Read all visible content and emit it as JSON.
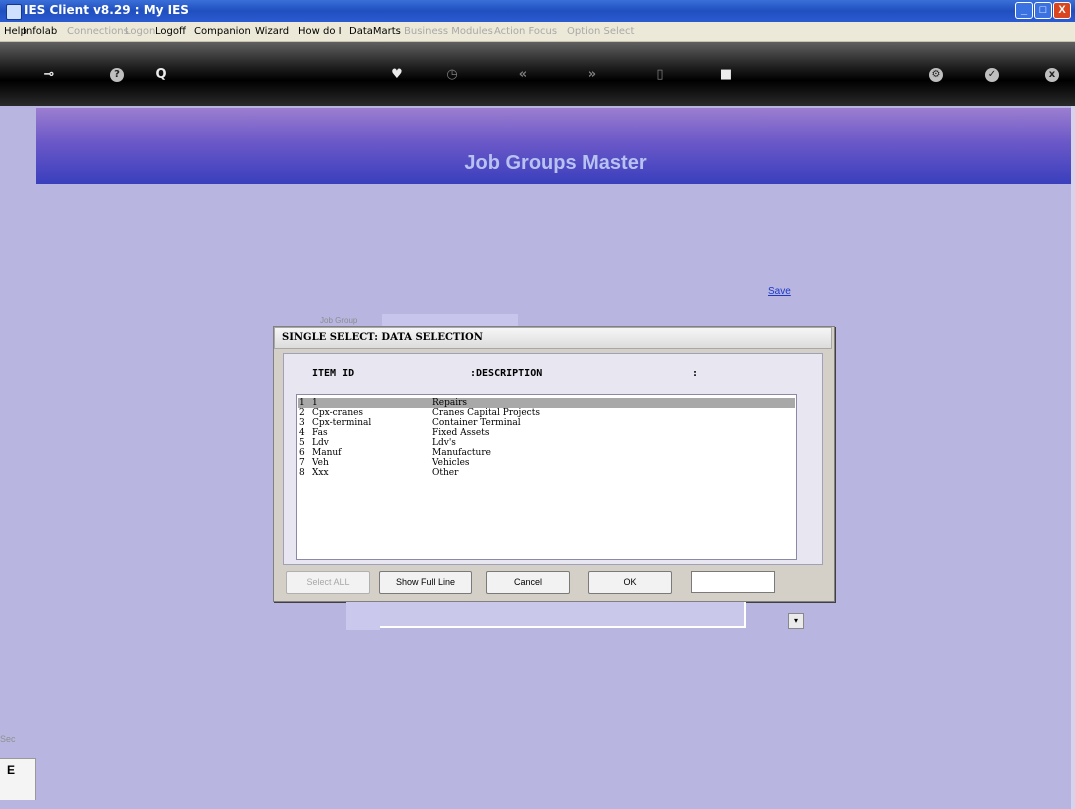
{
  "window": {
    "title": "IES Client v8.29 : My IES",
    "min_glyph": "_",
    "max_glyph": "□",
    "close_glyph": "X"
  },
  "menu": [
    {
      "label": "Help",
      "enabled": true
    },
    {
      "label": "Infolab",
      "enabled": true
    },
    {
      "label": "Connections",
      "enabled": false
    },
    {
      "label": "Logon",
      "enabled": false
    },
    {
      "label": "Logoff",
      "enabled": true
    },
    {
      "label": "Companion",
      "enabled": true
    },
    {
      "label": "Wizard",
      "enabled": true
    },
    {
      "label": "How do I",
      "enabled": true
    },
    {
      "label": "DataMarts",
      "enabled": true
    },
    {
      "label": "Business Modules",
      "enabled": false
    },
    {
      "label": "Action Focus",
      "enabled": false
    },
    {
      "label": "Option Select",
      "enabled": false
    }
  ],
  "toolbar": {
    "icons": [
      "key-icon",
      "help-icon",
      "search-icon",
      "heart-icon",
      "clock-icon",
      "rewind-icon",
      "fast-forward-icon",
      "trash-icon",
      "stop-icon",
      "settings-icon",
      "check-icon",
      "close-icon"
    ],
    "glyphs": {
      "key": "⊸",
      "help": "?",
      "search": "Q",
      "heart": "♥",
      "clock": "◷",
      "rewind": "«",
      "forward": "»",
      "trash": "▯",
      "stop": "■",
      "settings": "⚙",
      "check": "✓",
      "close": "x"
    }
  },
  "page": {
    "title": "Job Groups Master",
    "save_link": "Save",
    "job_group_label": "Job Group"
  },
  "dialog": {
    "title": "SINGLE SELECT: DATA SELECTION",
    "col_item": "ITEM ID",
    "col_desc": ":DESCRIPTION",
    "col_end": ":",
    "rows": [
      {
        "n": "1",
        "id": "1",
        "desc": "Repairs",
        "selected": true
      },
      {
        "n": "2",
        "id": "Cpx-cranes",
        "desc": "Cranes Capital Projects",
        "selected": false
      },
      {
        "n": "3",
        "id": "Cpx-terminal",
        "desc": "Container Terminal",
        "selected": false
      },
      {
        "n": "4",
        "id": "Fas",
        "desc": "Fixed Assets",
        "selected": false
      },
      {
        "n": "5",
        "id": "Ldv",
        "desc": "Ldv's",
        "selected": false
      },
      {
        "n": "6",
        "id": "Manuf",
        "desc": "Manufacture",
        "selected": false
      },
      {
        "n": "7",
        "id": "Veh",
        "desc": "Vehicles",
        "selected": false
      },
      {
        "n": "8",
        "id": "Xxx",
        "desc": "Other",
        "selected": false
      }
    ],
    "buttons": {
      "select_all": "Select ALL",
      "show_full_line": "Show Full Line",
      "cancel": "Cancel",
      "ok": "OK"
    },
    "search_value": ""
  },
  "combo": {
    "arrow_glyph": "▾"
  },
  "sidebar": {
    "label": "Sec",
    "icon_text": "E"
  }
}
